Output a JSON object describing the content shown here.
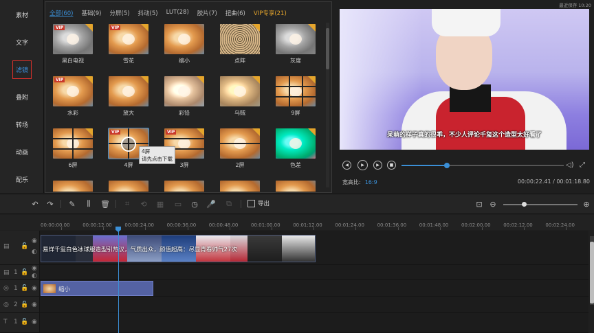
{
  "save_status": "最近保存 10:20",
  "leftnav": {
    "items": [
      {
        "label": "素材",
        "active": false
      },
      {
        "label": "文字",
        "active": false
      },
      {
        "label": "滤镜",
        "active": true
      },
      {
        "label": "叠附",
        "active": false
      },
      {
        "label": "转场",
        "active": false
      },
      {
        "label": "动画",
        "active": false
      },
      {
        "label": "配乐",
        "active": false
      }
    ]
  },
  "filters": {
    "tabs": [
      {
        "label": "全部(60)",
        "active": true
      },
      {
        "label": "基础(9)"
      },
      {
        "label": "分屏(5)"
      },
      {
        "label": "抖动(5)"
      },
      {
        "label": "LUT(28)"
      },
      {
        "label": "胶片(7)"
      },
      {
        "label": "扭曲(6)"
      },
      {
        "label": "VIP专享(21)",
        "vip": true
      }
    ],
    "vip_text": "VIP",
    "items": [
      {
        "label": "黑白电视",
        "vip": true,
        "style": "bw"
      },
      {
        "label": "雪花",
        "vip": true,
        "style": "plain"
      },
      {
        "label": "缩小",
        "vip": false,
        "style": "plain"
      },
      {
        "label": "点阵",
        "vip": false,
        "style": "dot"
      },
      {
        "label": "灰度",
        "vip": false,
        "style": "bw"
      },
      {
        "label": "水彩",
        "vip": true,
        "style": "plain"
      },
      {
        "label": "放大",
        "vip": false,
        "style": "plain"
      },
      {
        "label": "彩铅",
        "vip": false,
        "style": "sketch"
      },
      {
        "label": "乌贼",
        "vip": false,
        "style": "warm"
      },
      {
        "label": "9屏",
        "vip": false,
        "style": "split9"
      },
      {
        "label": "6屏",
        "vip": false,
        "style": "split6"
      },
      {
        "label": "4屏",
        "vip": true,
        "style": "split4"
      },
      {
        "label": "3屏",
        "vip": true,
        "style": "split3"
      },
      {
        "label": "2屏",
        "vip": false,
        "style": "split2"
      },
      {
        "label": "色差",
        "vip": false,
        "style": "color"
      }
    ],
    "tooltip_title": "4屏",
    "tooltip_hint": "请先点击下载"
  },
  "preview": {
    "subtitle": "呆萌的样子真的很乖，不少人评论千玺这个造型太好看了",
    "ratio_label": "宽高比:",
    "ratio_value": "16:9",
    "timecode": "00:00:22.41 / 00:01:18.80",
    "progress": 0.28
  },
  "toolbar": {
    "export_label": "导出",
    "zoom_level": 0.28
  },
  "ruler": {
    "labels": [
      "00:00:00.00",
      "00:00:12.00",
      "00:00:24.00",
      "00:00:36.00",
      "00:00:48.00",
      "00:01:00.00",
      "00:01:12.00",
      "00:01:24.00",
      "00:01:36.00",
      "00:01:48.00",
      "00:02:00.00",
      "00:02:12.00",
      "00:02:24.00"
    ]
  },
  "timeline": {
    "main_clip_title": "易烊千玺白色冰球服造型引热议，气质出众，颜值超高：尽显青春帅气27次",
    "filter_clip_label": "缩小",
    "track_numbers": [
      "1",
      "1",
      "2",
      "1"
    ]
  }
}
